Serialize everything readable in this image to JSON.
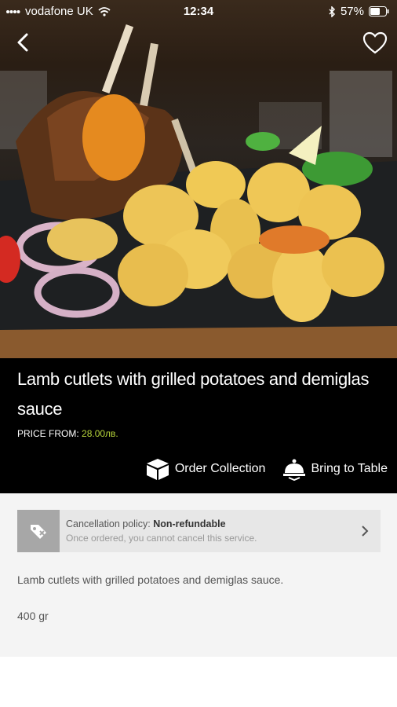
{
  "status": {
    "carrier": "vodafone UK",
    "time": "12:34",
    "battery": "57%"
  },
  "product": {
    "title": "Lamb cutlets with grilled potatoes and demiglas sauce",
    "price_label": "PRICE FROM:",
    "price_value": "28.00лв.",
    "description": "Lamb cutlets with grilled potatoes and demiglas sauce.",
    "weight": "400 gr"
  },
  "actions": {
    "order_collection": "Order Collection",
    "bring_to_table": "Bring to Table"
  },
  "policy": {
    "label": "Cancellation policy:",
    "value": "Non-refundable",
    "note": "Once ordered, you cannot cancel this service."
  },
  "colors": {
    "price_accent": "#b5d33a",
    "info_background": "#000000"
  },
  "icons": [
    "back-arrow-icon",
    "heart-icon",
    "box-icon",
    "cloche-icon",
    "tag-icon",
    "chevron-right-icon"
  ]
}
